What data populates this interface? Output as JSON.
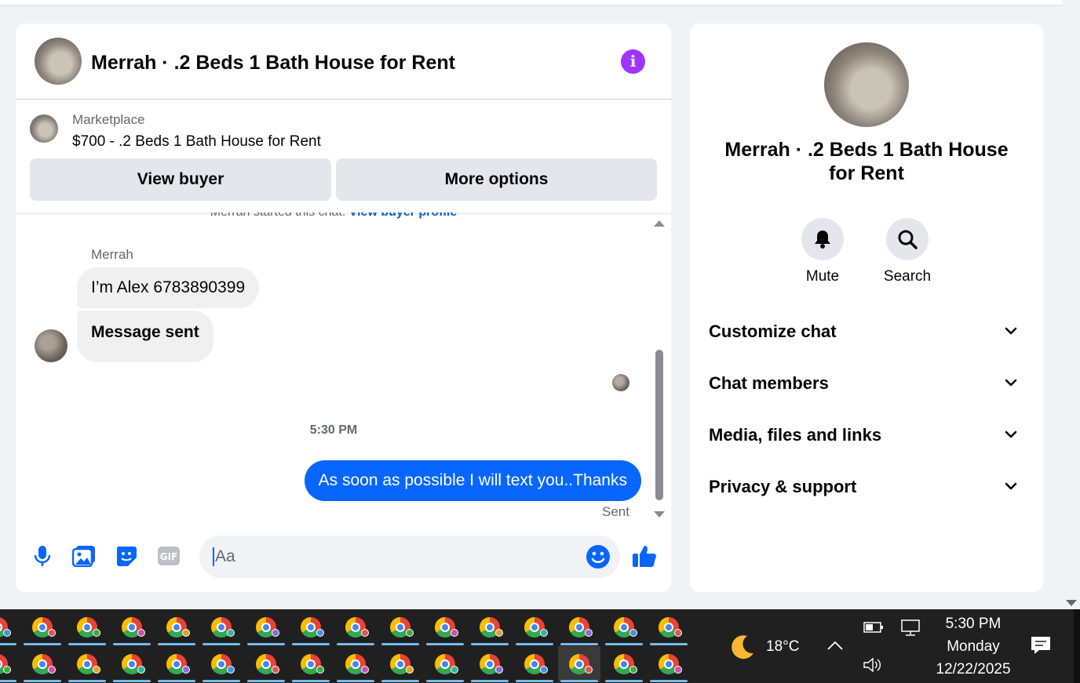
{
  "chat": {
    "title": "Merrah · .2 Beds 1 Bath House for Rent",
    "listing": {
      "source": "Marketplace",
      "title": "$700 - .2 Beds 1 Bath House for Rent",
      "view_buyer_label": "View buyer",
      "more_options_label": "More options"
    },
    "started_text": "Merrah started this chat.",
    "started_link": "View buyer profile",
    "sender_name": "Merrah",
    "messages_in": [
      "I’m Alex 6783890399",
      "Message sent"
    ],
    "timestamp": "5:30 PM",
    "message_out": "As soon as possible I will text you..Thanks",
    "sent_status": "Sent",
    "composer_placeholder": "Aa",
    "accent_color": "#0866ff",
    "info_color": "#a033ff"
  },
  "info_panel": {
    "title": "Merrah · .2 Beds 1 Bath House for Rent",
    "mute_label": "Mute",
    "search_label": "Search",
    "sections": [
      "Customize chat",
      "Chat members",
      "Media, files and links",
      "Privacy & support"
    ]
  },
  "taskbar": {
    "weather": "18°C",
    "time": "5:30 PM",
    "day": "Monday",
    "date": "12/22/2025",
    "profile_colors": [
      "#4a90e2",
      "#e05555",
      "#45a845",
      "#d04fb0",
      "#e0a030",
      "#3ab0a0",
      "#8e6ad8"
    ]
  }
}
